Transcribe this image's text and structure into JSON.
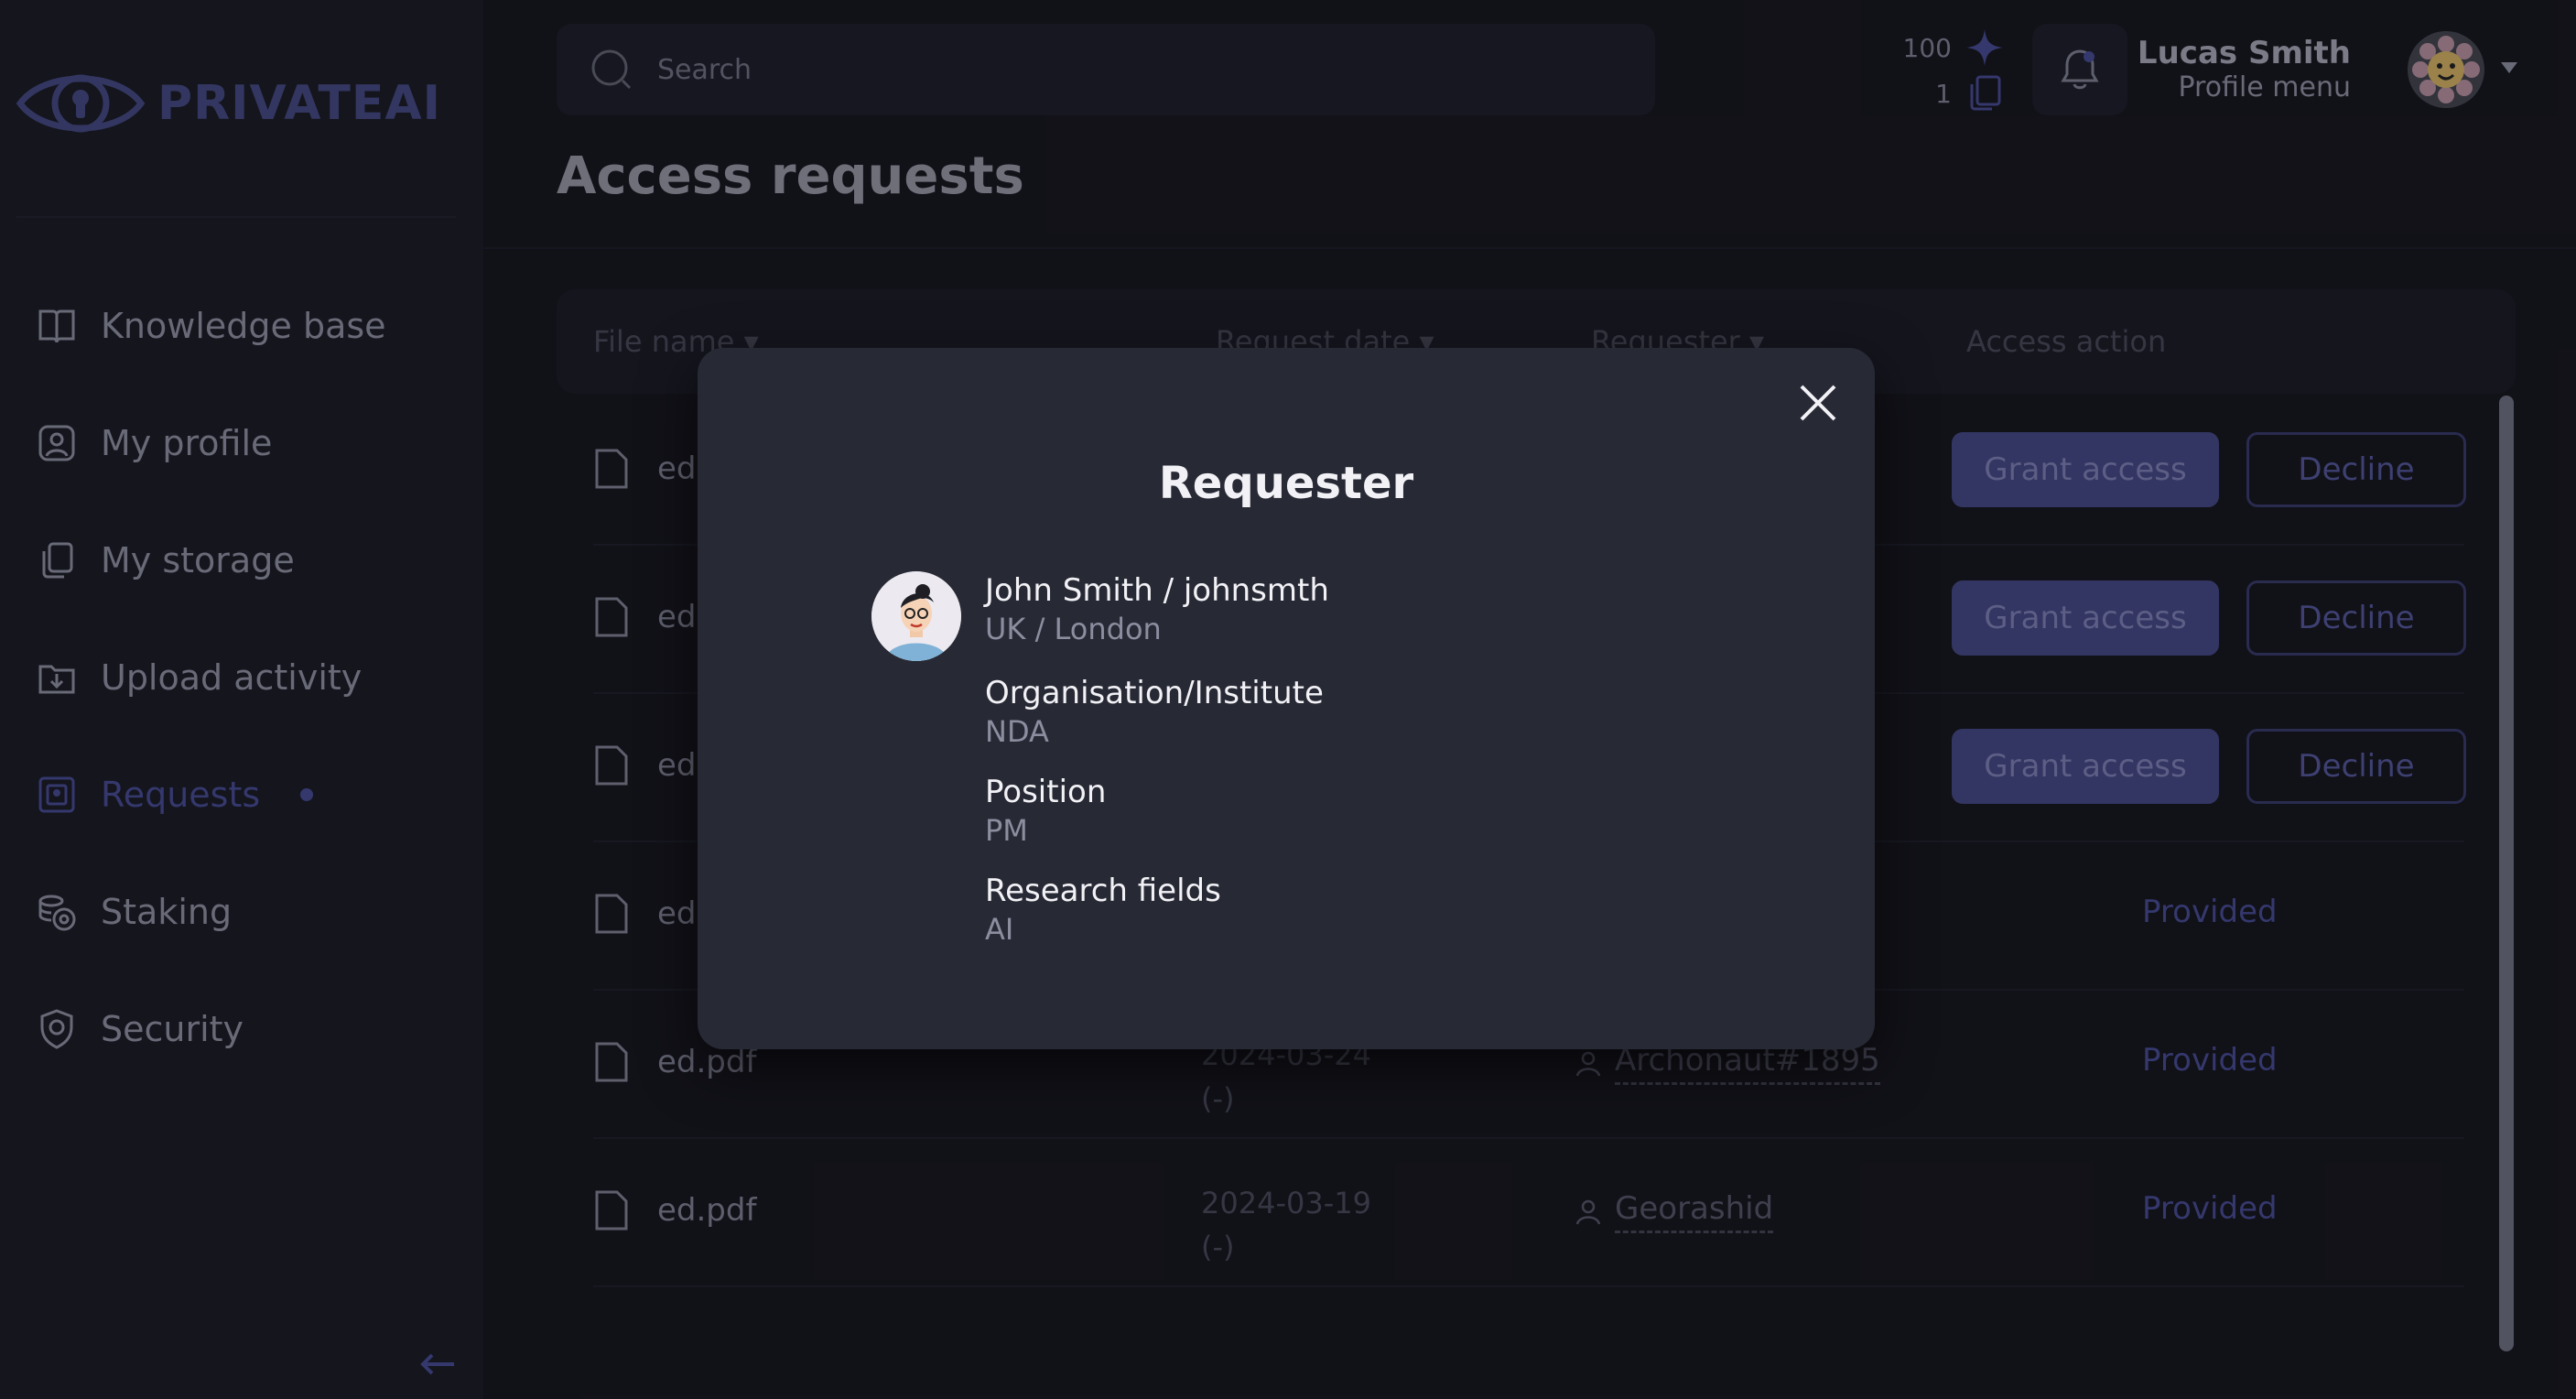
{
  "brand": {
    "name": "PRIVATEAI",
    "accent": "#4e52a0"
  },
  "sidebar": {
    "items": [
      {
        "label": "Knowledge base",
        "icon": "book-icon"
      },
      {
        "label": "My profile",
        "icon": "profile-icon"
      },
      {
        "label": "My storage",
        "icon": "storage-icon"
      },
      {
        "label": "Upload activity",
        "icon": "upload-icon"
      },
      {
        "label": "Requests",
        "icon": "requests-icon",
        "active": true,
        "has_notification": true
      },
      {
        "label": "Staking",
        "icon": "coins-icon"
      },
      {
        "label": "Security",
        "icon": "shield-icon"
      }
    ],
    "collapse_icon": "arrow-left-icon"
  },
  "topbar": {
    "search_placeholder": "Search",
    "stats": {
      "points": "100",
      "files": "1"
    },
    "user": {
      "name": "Lucas Smith",
      "subtitle": "Profile menu"
    }
  },
  "page": {
    "title": "Access requests"
  },
  "table": {
    "columns": [
      "File name ▾",
      "Request date ▾",
      "Requester ▾",
      "Access action"
    ],
    "rows": [
      {
        "file": "ed.pdf",
        "date": "",
        "date_sub": "",
        "requester": "",
        "status": "pending"
      },
      {
        "file": "ed.pdf",
        "date": "",
        "date_sub": "",
        "requester": "",
        "status": "pending"
      },
      {
        "file": "ed.pdf",
        "date": "",
        "date_sub": "",
        "requester": "",
        "status": "pending"
      },
      {
        "file": "ed.pdf",
        "date": "",
        "date_sub": "",
        "requester": "johnsmth",
        "status": "provided"
      },
      {
        "file": "ed.pdf",
        "date": "2024-03-24",
        "date_sub": "(-)",
        "requester": "Archonaut#1895",
        "status": "provided"
      },
      {
        "file": "ed.pdf",
        "date": "2024-03-19",
        "date_sub": "(-)",
        "requester": "Georashid",
        "status": "provided"
      }
    ],
    "grant_label": "Grant access",
    "decline_label": "Decline",
    "provided_label": "Provided"
  },
  "modal": {
    "title": "Requester",
    "name": "John Smith / johnsmth",
    "location": "UK / London",
    "fields": [
      {
        "label": "Organisation/Institute",
        "value": "NDA"
      },
      {
        "label": "Position",
        "value": "PM"
      },
      {
        "label": "Research fields",
        "value": "AI"
      }
    ]
  }
}
